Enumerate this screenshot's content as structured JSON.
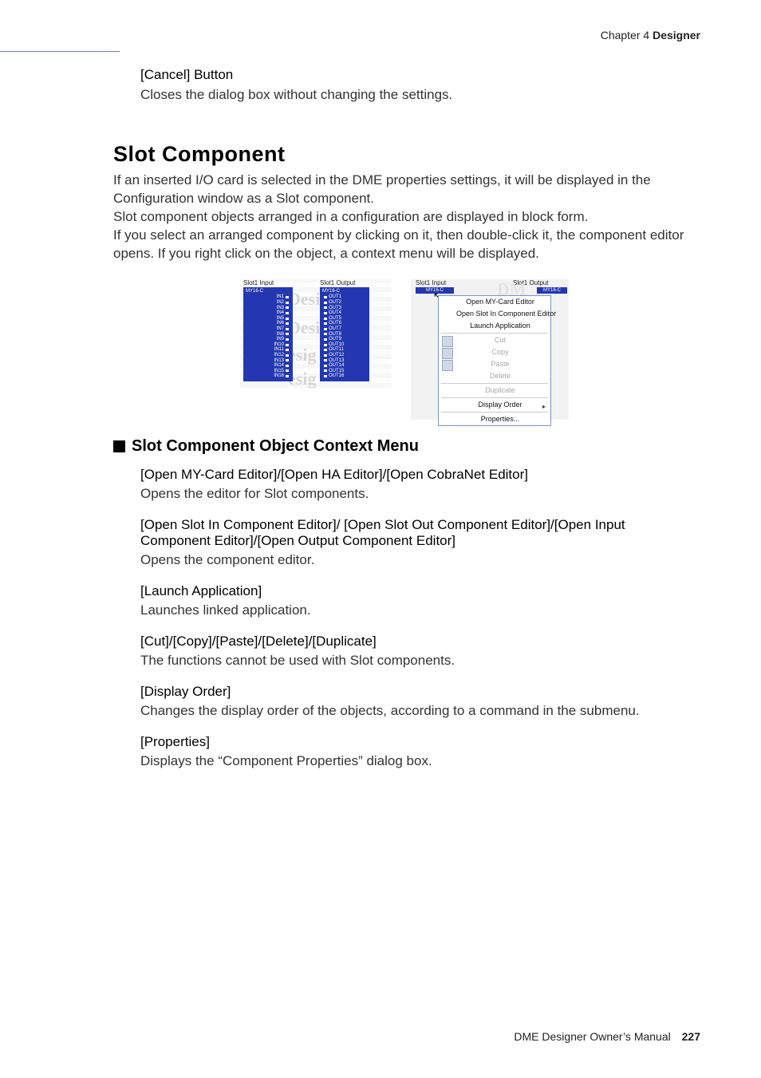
{
  "header": {
    "pre": "Chapter 4  ",
    "bold": "Designer"
  },
  "cancel": {
    "title": "[Cancel] Button",
    "body": "Closes the dialog box without changing the settings."
  },
  "slot": {
    "heading": "Slot Component",
    "p1": "If an inserted I/O card is selected in the DME properties settings, it will be displayed in the Configuration window as a Slot component.",
    "p2": "Slot component objects arranged in a configuration are displayed in block form.",
    "p3": "If you select an arranged component by clicking on it, then double-click it, the component editor opens. If you right click on the object, a context menu will be displayed."
  },
  "fig": {
    "left": {
      "label_in": "Slot1 Input",
      "label_out": "Slot1 Output",
      "card": "MY16-C",
      "ins": [
        "IN1",
        "IN2",
        "IN3",
        "IN4",
        "IN5",
        "IN6",
        "IN7",
        "IN8",
        "IN9",
        "IN10",
        "IN11",
        "IN12",
        "IN13",
        "IN14",
        "IN15",
        "IN16"
      ],
      "outs": [
        "OUT1",
        "OUT2",
        "OUT3",
        "OUT4",
        "OUT5",
        "OUT6",
        "OUT7",
        "OUT8",
        "OUT9",
        "OUT10",
        "OUT11",
        "OUT12",
        "OUT13",
        "OUT14",
        "OUT15",
        "OUT16"
      ]
    },
    "right": {
      "label_in": "Slot1 Input",
      "label_out": "Slot1 Output",
      "card": "MY16-C",
      "menu": {
        "m1": "Open MY-Card Editor",
        "m2": "Open Slot In Component Editor",
        "m3": "Launch Application",
        "m4": "Cut",
        "m5": "Copy",
        "m6": "Paste",
        "m7": "Delete",
        "m8": "Duplicate",
        "m9": "Display Order",
        "m10": "Properties..."
      }
    }
  },
  "ctx": {
    "heading": "Slot Component Object Context Menu",
    "i1": {
      "t": "[Open MY-Card Editor]/[Open HA Editor]/[Open CobraNet Editor]",
      "d": "Opens the editor for Slot components."
    },
    "i2": {
      "t": "[Open Slot In Component Editor]/ [Open Slot Out Component Editor]/[Open Input Component Editor]/[Open Output Component Editor]",
      "d": "Opens the component editor."
    },
    "i3": {
      "t": "[Launch Application]",
      "d": "Launches linked application."
    },
    "i4": {
      "t": "[Cut]/[Copy]/[Paste]/[Delete]/[Duplicate]",
      "d": "The functions cannot be used with Slot components."
    },
    "i5": {
      "t": "[Display Order]",
      "d": "Changes the display order of the objects, according to a command in the submenu."
    },
    "i6": {
      "t": "[Properties]",
      "d": "Displays the “Component Properties” dialog box."
    }
  },
  "footer": {
    "text": "DME Designer Owner’s Manual",
    "page": "227"
  }
}
